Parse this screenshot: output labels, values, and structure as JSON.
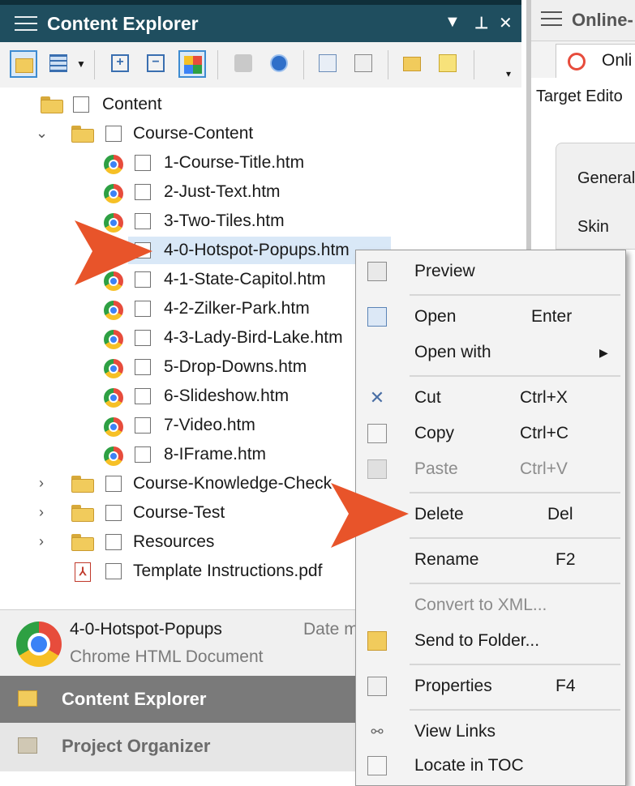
{
  "left_panel": {
    "title": "Content Explorer",
    "controls": {
      "dropdown": "▼",
      "pin": "⊥",
      "close": "✕"
    }
  },
  "tree": {
    "root": "Content",
    "items": [
      {
        "label": "Course-Content",
        "type": "folder",
        "expanded": true
      },
      {
        "label": "1-Course-Title.htm",
        "type": "file"
      },
      {
        "label": "2-Just-Text.htm",
        "type": "file"
      },
      {
        "label": "3-Two-Tiles.htm",
        "type": "file"
      },
      {
        "label": "4-0-Hotspot-Popups.htm",
        "type": "file",
        "selected": true
      },
      {
        "label": "4-1-State-Capitol.htm",
        "type": "file"
      },
      {
        "label": "4-2-Zilker-Park.htm",
        "type": "file"
      },
      {
        "label": "4-3-Lady-Bird-Lake.htm",
        "type": "file"
      },
      {
        "label": "5-Drop-Downs.htm",
        "type": "file"
      },
      {
        "label": "6-Slideshow.htm",
        "type": "file"
      },
      {
        "label": "7-Video.htm",
        "type": "file"
      },
      {
        "label": "8-IFrame.htm",
        "type": "file"
      },
      {
        "label": "Course-Knowledge-Check",
        "type": "folder",
        "expanded": false
      },
      {
        "label": "Course-Test",
        "type": "folder",
        "expanded": false
      },
      {
        "label": "Resources",
        "type": "folder",
        "expanded": false
      },
      {
        "label": "Template Instructions.pdf",
        "type": "pdf"
      }
    ]
  },
  "status": {
    "name": "4-0-Hotspot-Popups",
    "type": "Chrome HTML Document",
    "date_label": "Date m"
  },
  "nav": {
    "content_explorer": "Content Explorer",
    "project_organizer": "Project Organizer"
  },
  "right_panel": {
    "title": "Online-",
    "tab": "Onli",
    "target_label": "Target Edito",
    "general": "General",
    "skin": "Skin"
  },
  "context_menu": {
    "preview": "Preview",
    "open": "Open",
    "open_sc": "Enter",
    "open_with": "Open with",
    "cut": "Cut",
    "cut_sc": "Ctrl+X",
    "copy": "Copy",
    "copy_sc": "Ctrl+C",
    "paste": "Paste",
    "paste_sc": "Ctrl+V",
    "delete": "Delete",
    "delete_sc": "Del",
    "rename": "Rename",
    "rename_sc": "F2",
    "convert": "Convert to XML...",
    "send": "Send to Folder...",
    "properties": "Properties",
    "properties_sc": "F4",
    "view_links": "View Links",
    "locate": "Locate in TOC"
  },
  "colors": {
    "title_bar": "#1f4e5f",
    "arrow": "#e8542a",
    "selection": "#d9e8f7"
  }
}
